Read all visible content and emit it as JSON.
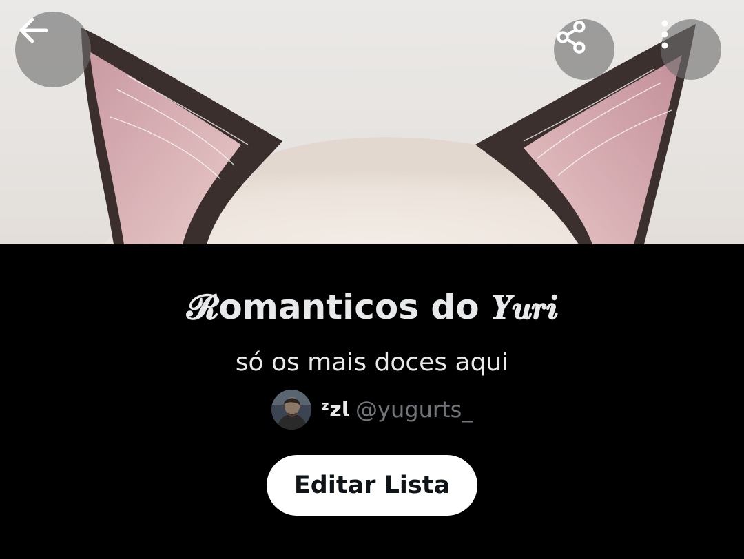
{
  "header": {
    "back_icon": "arrow-left-icon",
    "share_icon": "share-icon",
    "more_icon": "more-vertical-icon",
    "banner_image": "cat-ears-banner"
  },
  "list": {
    "title": "𝓡omanticos do 𝒀𝒖𝒓𝒊",
    "description": "só os mais doces aqui",
    "owner": {
      "name": "ᶻ𝘇𝗹",
      "handle": "@yugurts_",
      "avatar": "avatar-image"
    },
    "edit_label": "Editar Lista"
  },
  "colors": {
    "background": "#000000",
    "primary_text": "#e7e9ea",
    "secondary_text": "#71767b",
    "button_bg": "#ffffff",
    "button_text": "#0f1419",
    "overlay_button": "#6e6e6e"
  }
}
